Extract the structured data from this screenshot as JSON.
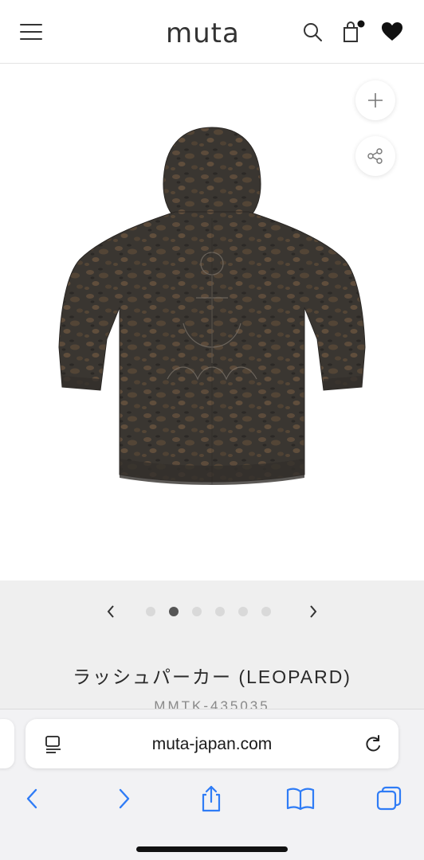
{
  "header": {
    "logo_text": "muta",
    "icons": [
      "menu-icon",
      "search-icon",
      "bag-icon",
      "heart-icon"
    ]
  },
  "gallery": {
    "image_alt": "hoodie-back-leopard-print",
    "slide_count": 6,
    "active_slide": 2,
    "icons": [
      "plus-icon",
      "share-icon",
      "chevron-left-icon",
      "chevron-right-icon"
    ]
  },
  "product": {
    "title": "ラッシュパーカー (LEOPARD)",
    "code": "MMTK-435035"
  },
  "browser": {
    "url": "muta-japan.com",
    "icons": [
      "page-menu-icon",
      "reload-icon",
      "back-icon",
      "forward-icon",
      "share-icon",
      "bookmarks-icon",
      "tabs-icon"
    ]
  },
  "colors": {
    "accent": "#333333",
    "gallery_band": "#efefef",
    "browser_accent": "#2f7cf6",
    "hoodie_base": "#3b3732",
    "hoodie_spot": "#5a4a3a"
  }
}
